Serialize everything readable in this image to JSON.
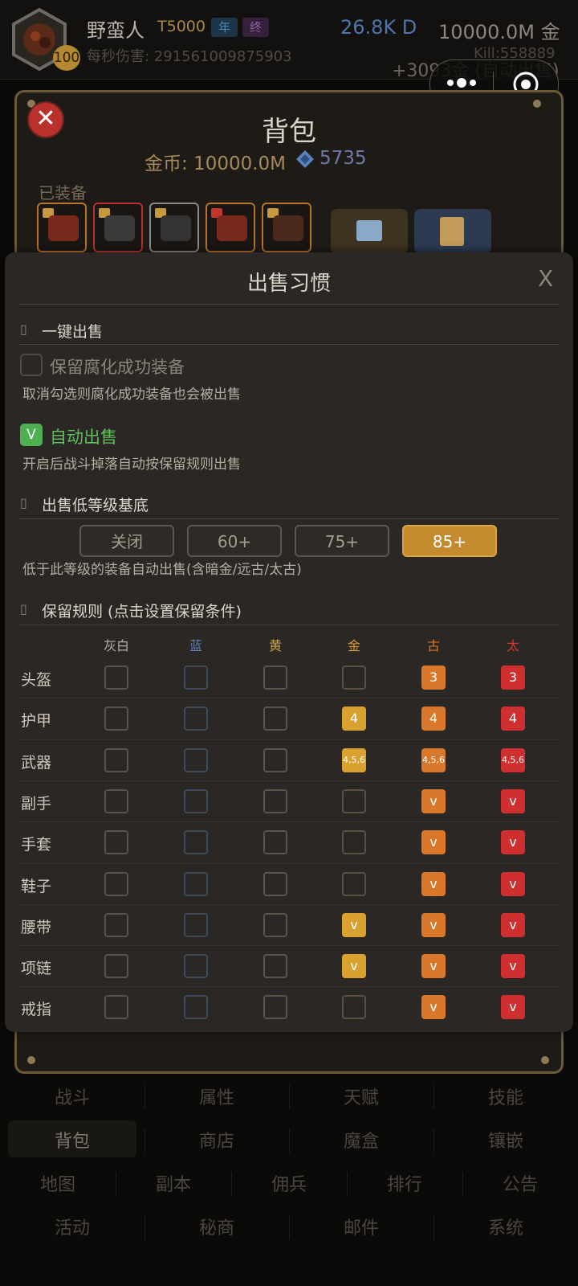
{
  "player": {
    "name": "野蛮人",
    "tier": "T5000",
    "tag_year": "年",
    "tag_final": "终",
    "level": "100",
    "dps_label": "每秒伤害: 291561009875903",
    "damage": "26.8K D",
    "gold": "10000.0M 金",
    "gold_rate": "+3093金 (自动出售)",
    "kills": "Kill:558889"
  },
  "bag": {
    "close": "✕",
    "title": "背包",
    "coins_label": "金币: 10000.0M",
    "gems": "5735",
    "equipped_label": "已装备"
  },
  "sell": {
    "title": "出售习惯",
    "close": "X",
    "section_mark": "▯",
    "one_click": {
      "title": "一键出售",
      "keep_corrupt_label": "保留腐化成功装备",
      "keep_corrupt_checked": false,
      "keep_corrupt_hint": "取消勾选则腐化成功装备也会被出售",
      "auto_sell_label": "自动出售",
      "auto_sell_checked": true,
      "auto_sell_check": "V",
      "auto_sell_hint": "开启后战斗掉落自动按保留规则出售"
    },
    "low_level": {
      "title": "出售低等级基底",
      "options": [
        "关闭",
        "60+",
        "75+",
        "85+"
      ],
      "selected": "85+",
      "hint": "低于此等级的装备自动出售(含暗金/远古/太古)"
    },
    "rules": {
      "title": "保留规则 (点击设置保留条件)",
      "columns": [
        "灰白",
        "蓝",
        "黄",
        "金",
        "古",
        "太"
      ],
      "column_colors": [
        "#b8b0a4",
        "#5d7fb8",
        "#c9a64a",
        "#d99a3a",
        "#e0752d",
        "#d9362f"
      ],
      "rows": [
        {
          "slot": "头盔",
          "cells": [
            "",
            "",
            "",
            "",
            "3",
            "3"
          ]
        },
        {
          "slot": "护甲",
          "cells": [
            "",
            "",
            "",
            "4",
            "4",
            "4"
          ]
        },
        {
          "slot": "武器",
          "cells": [
            "",
            "",
            "",
            "4,5,6",
            "4,5,6",
            "4,5,6"
          ]
        },
        {
          "slot": "副手",
          "cells": [
            "",
            "",
            "",
            "",
            "v",
            "v"
          ]
        },
        {
          "slot": "手套",
          "cells": [
            "",
            "",
            "",
            "",
            "v",
            "v"
          ]
        },
        {
          "slot": "鞋子",
          "cells": [
            "",
            "",
            "",
            "",
            "v",
            "v"
          ]
        },
        {
          "slot": "腰带",
          "cells": [
            "",
            "",
            "",
            "v",
            "v",
            "v"
          ]
        },
        {
          "slot": "项链",
          "cells": [
            "",
            "",
            "",
            "v",
            "v",
            "v"
          ]
        },
        {
          "slot": "戒指",
          "cells": [
            "",
            "",
            "",
            "",
            "v",
            "v"
          ]
        }
      ]
    }
  },
  "nav": {
    "row1": [
      "战斗",
      "属性",
      "天赋",
      "技能"
    ],
    "row2": [
      "背包",
      "商店",
      "魔盒",
      "镶嵌"
    ],
    "row3": [
      "地图",
      "副本",
      "佣兵",
      "排行",
      "公告"
    ],
    "row4": [
      "活动",
      "秘商",
      "邮件",
      "系统"
    ]
  }
}
